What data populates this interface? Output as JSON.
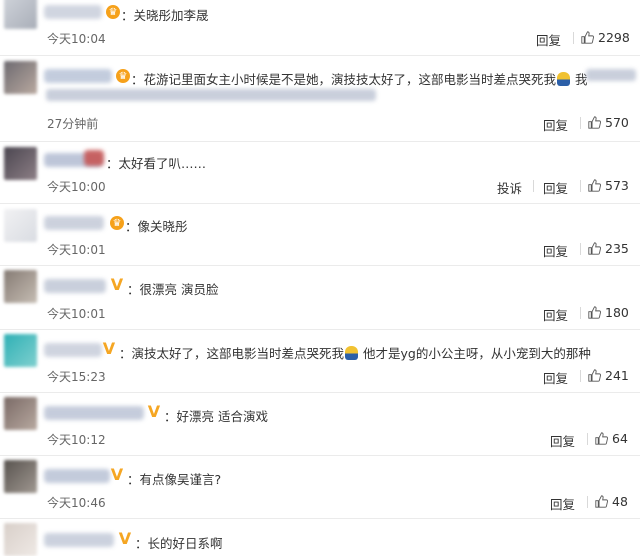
{
  "comments": [
    {
      "text": "：关晓彤加李晟",
      "time": "今天10:04",
      "reply_label": "回复",
      "likes": "2298",
      "badge": "crown"
    },
    {
      "text": "：花游记里面女主小时候是不是她，演技技太好了，这部电影当时差点哭死我",
      "text_tail": "我",
      "time": "27分钟前",
      "reply_label": "回复",
      "likes": "570",
      "badge": "crown"
    },
    {
      "text": "：太好看了叭……",
      "time": "今天10:00",
      "report_label": "投诉",
      "reply_label": "回复",
      "likes": "573",
      "badge": "none"
    },
    {
      "text": "：像关晓彤",
      "time": "今天10:01",
      "reply_label": "回复",
      "likes": "235",
      "badge": "crown"
    },
    {
      "text": "：很漂亮 演员脸",
      "time": "今天10:01",
      "reply_label": "回复",
      "likes": "180",
      "badge": "v"
    },
    {
      "text": "：演技太好了，这部电影当时差点哭死我",
      "text_tail": "他才是yg的小公主呀，从小宠到大的那种",
      "time": "今天15:23",
      "reply_label": "回复",
      "likes": "241",
      "badge": "v"
    },
    {
      "text": "：好漂亮 适合演戏",
      "time": "今天10:12",
      "reply_label": "回复",
      "likes": "64",
      "badge": "v"
    },
    {
      "text": "：有点像吴谨言?",
      "time": "今天10:46",
      "reply_label": "回复",
      "likes": "48",
      "badge": "v"
    },
    {
      "text": "：长的好日系啊",
      "badge": "v"
    }
  ],
  "colors": {
    "badge_gold": "#f5a623",
    "divider": "#ebebeb",
    "text": "#333333",
    "meta": "#666666"
  },
  "icons": {
    "like": "thumbs-up-icon",
    "crown": "crown-badge-icon",
    "verified": "verified-v-icon",
    "emoji": "doge-emoji-icon"
  }
}
